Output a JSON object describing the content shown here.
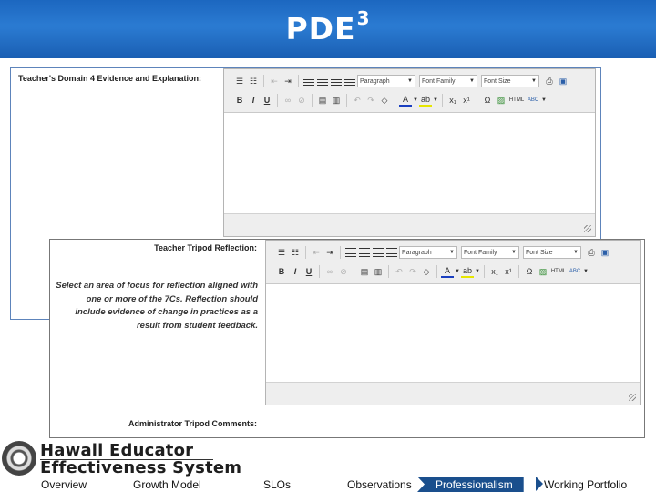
{
  "header": {
    "title": "PDE",
    "superscript": "3",
    "bg_color": "#2b7bd2"
  },
  "panel1": {
    "label": "Teacher's Domain 4 Evidence and Explanation:",
    "toolbar": {
      "paragraph": "Paragraph",
      "font_family": "Font Family",
      "font_size": "Font Size"
    }
  },
  "panel2": {
    "label": "Teacher Tripod Reflection:",
    "instructions": "Select an area of focus for reflection aligned with one or more of the 7Cs. Reflection should include evidence of change in practices as a result from student feedback.",
    "admin_label": "Administrator Tripod Comments:",
    "toolbar": {
      "paragraph": "Paragraph",
      "font_family": "Font Family",
      "font_size": "Font Size"
    }
  },
  "footer": {
    "brand_line1": "Hawaii Educator",
    "brand_line2": "Effectiveness System",
    "nav": {
      "overview": "Overview",
      "growth_model": "Growth Model",
      "slos": "SLOs",
      "observations": "Observations",
      "professionalism": "Professionalism",
      "working_portfolio": "Working Portfolio"
    },
    "active_color": "#1a4f8d"
  },
  "icons": {
    "bold": "B",
    "italic": "I",
    "underline": "U",
    "subscript": "x₁",
    "superscript": "x¹",
    "omega": "Ω",
    "html": "HTML",
    "spell": "ABC"
  }
}
